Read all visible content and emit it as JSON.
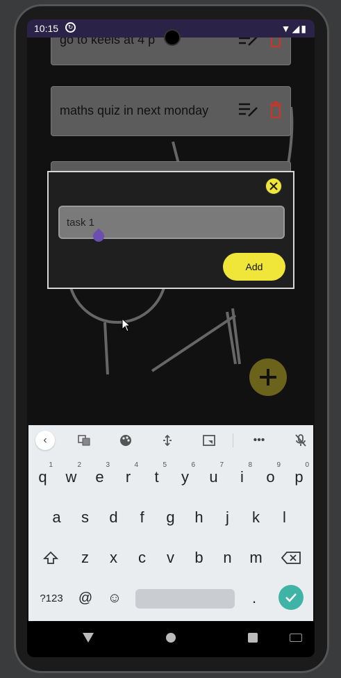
{
  "status_bar": {
    "time": "10:15",
    "notification_icon": "sync-icon",
    "right_icons": "▼◢▮"
  },
  "tasks": [
    {
      "text": "go to keels at 4 p"
    },
    {
      "text": "maths quiz in next monday"
    }
  ],
  "dialog": {
    "input_value": "task 1",
    "add_label": "Add",
    "close_icon": "close-icon"
  },
  "fab": {
    "icon": "plus-icon"
  },
  "keyboard": {
    "toolbar": [
      "chevron-left-icon",
      "translate-icon",
      "palette-icon",
      "cursor-move-icon",
      "screenshot-icon",
      "more-icon",
      "mic-off-icon"
    ],
    "row1": [
      {
        "key": "q",
        "num": "1"
      },
      {
        "key": "w",
        "num": "2"
      },
      {
        "key": "e",
        "num": "3"
      },
      {
        "key": "r",
        "num": "4"
      },
      {
        "key": "t",
        "num": "5"
      },
      {
        "key": "y",
        "num": "6"
      },
      {
        "key": "u",
        "num": "7"
      },
      {
        "key": "i",
        "num": "8"
      },
      {
        "key": "o",
        "num": "9"
      },
      {
        "key": "p",
        "num": "0"
      }
    ],
    "row2": [
      "a",
      "s",
      "d",
      "f",
      "g",
      "h",
      "j",
      "k",
      "l"
    ],
    "row3": [
      "z",
      "x",
      "c",
      "v",
      "b",
      "n",
      "m"
    ],
    "symbols_label": "?123",
    "at_label": "@",
    "emoji_label": "☺",
    "period_label": ".",
    "shift_icon": "shift-icon",
    "backspace_icon": "backspace-icon",
    "enter_icon": "check-icon"
  },
  "colors": {
    "accent_yellow": "#f0e63a",
    "fab": "#6b631b",
    "enter": "#3fb3a6",
    "delete_red": "#c0392b"
  }
}
